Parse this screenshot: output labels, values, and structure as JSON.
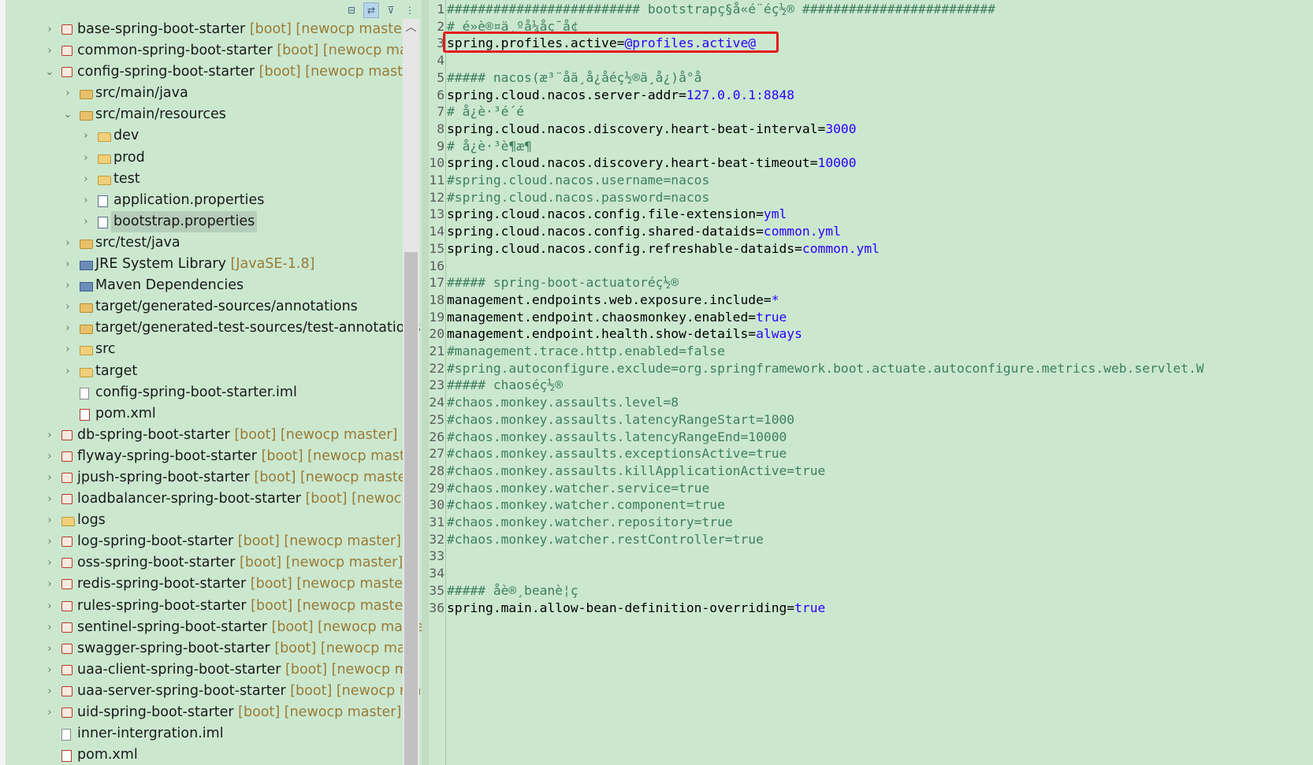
{
  "tree": {
    "items": [
      {
        "depth": 0,
        "exp": "collapsed",
        "icon": "project",
        "name": "base-spring-boot-starter",
        "deco": " [boot] [newocp master]"
      },
      {
        "depth": 0,
        "exp": "collapsed",
        "icon": "project",
        "name": "common-spring-boot-starter",
        "deco": " [boot] [newocp mas"
      },
      {
        "depth": 0,
        "exp": "expanded",
        "icon": "project",
        "name": "config-spring-boot-starter",
        "deco": " [boot] [newocp master"
      },
      {
        "depth": 1,
        "exp": "collapsed",
        "icon": "srcfolder",
        "name": "src/main/java",
        "deco": ""
      },
      {
        "depth": 1,
        "exp": "expanded",
        "icon": "srcfolder",
        "name": "src/main/resources",
        "deco": ""
      },
      {
        "depth": 2,
        "exp": "collapsed",
        "icon": "folder",
        "name": "dev",
        "deco": ""
      },
      {
        "depth": 2,
        "exp": "collapsed",
        "icon": "folder",
        "name": "prod",
        "deco": ""
      },
      {
        "depth": 2,
        "exp": "collapsed",
        "icon": "folder",
        "name": "test",
        "deco": ""
      },
      {
        "depth": 2,
        "exp": "collapsed",
        "icon": "pfile",
        "name": "application.properties",
        "deco": ""
      },
      {
        "depth": 2,
        "exp": "collapsed",
        "icon": "pfile",
        "name": "bootstrap.properties",
        "deco": "",
        "selected": true
      },
      {
        "depth": 1,
        "exp": "collapsed",
        "icon": "srcfolder",
        "name": "src/test/java",
        "deco": ""
      },
      {
        "depth": 1,
        "exp": "collapsed",
        "icon": "lib",
        "name": "JRE System Library",
        "deco": " [JavaSE-1.8]"
      },
      {
        "depth": 1,
        "exp": "collapsed",
        "icon": "lib",
        "name": "Maven Dependencies",
        "deco": ""
      },
      {
        "depth": 1,
        "exp": "collapsed",
        "icon": "srcfolder",
        "name": "target/generated-sources/annotations",
        "deco": ""
      },
      {
        "depth": 1,
        "exp": "collapsed",
        "icon": "srcfolder",
        "name": "target/generated-test-sources/test-annotations",
        "deco": ""
      },
      {
        "depth": 1,
        "exp": "collapsed",
        "icon": "folder",
        "name": "src",
        "deco": ""
      },
      {
        "depth": 1,
        "exp": "collapsed",
        "icon": "folder",
        "name": "target",
        "deco": ""
      },
      {
        "depth": 1,
        "exp": "none",
        "icon": "file",
        "name": "config-spring-boot-starter.iml",
        "deco": ""
      },
      {
        "depth": 1,
        "exp": "none",
        "icon": "xml",
        "name": "pom.xml",
        "deco": ""
      },
      {
        "depth": 0,
        "exp": "collapsed",
        "icon": "project",
        "name": "db-spring-boot-starter",
        "deco": " [boot] [newocp master]"
      },
      {
        "depth": 0,
        "exp": "collapsed",
        "icon": "project",
        "name": "flyway-spring-boot-starter",
        "deco": " [boot] [newocp master"
      },
      {
        "depth": 0,
        "exp": "collapsed",
        "icon": "project",
        "name": "jpush-spring-boot-starter",
        "deco": " [boot] [newocp master]"
      },
      {
        "depth": 0,
        "exp": "collapsed",
        "icon": "project",
        "name": "loadbalancer-spring-boot-starter",
        "deco": " [boot] [newocp"
      },
      {
        "depth": 0,
        "exp": "collapsed",
        "icon": "folder",
        "name": "logs",
        "deco": ""
      },
      {
        "depth": 0,
        "exp": "collapsed",
        "icon": "project",
        "name": "log-spring-boot-starter",
        "deco": " [boot] [newocp master]"
      },
      {
        "depth": 0,
        "exp": "collapsed",
        "icon": "project",
        "name": "oss-spring-boot-starter",
        "deco": " [boot] [newocp master]"
      },
      {
        "depth": 0,
        "exp": "collapsed",
        "icon": "project",
        "name": "redis-spring-boot-starter",
        "deco": " [boot] [newocp master]"
      },
      {
        "depth": 0,
        "exp": "collapsed",
        "icon": "project",
        "name": "rules-spring-boot-starter",
        "deco": " [boot] [newocp master]"
      },
      {
        "depth": 0,
        "exp": "collapsed",
        "icon": "project",
        "name": "sentinel-spring-boot-starter",
        "deco": " [boot] [newocp maste"
      },
      {
        "depth": 0,
        "exp": "collapsed",
        "icon": "project",
        "name": "swagger-spring-boot-starter",
        "deco": " [boot] [newocp mast"
      },
      {
        "depth": 0,
        "exp": "collapsed",
        "icon": "project",
        "name": "uaa-client-spring-boot-starter",
        "deco": " [boot] [newocp ma"
      },
      {
        "depth": 0,
        "exp": "collapsed",
        "icon": "project",
        "name": "uaa-server-spring-boot-starter",
        "deco": " [boot] [newocp ma"
      },
      {
        "depth": 0,
        "exp": "collapsed",
        "icon": "project",
        "name": "uid-spring-boot-starter",
        "deco": " [boot] [newocp master]"
      },
      {
        "depth": 0,
        "exp": "none",
        "icon": "file",
        "name": "inner-intergration.iml",
        "deco": ""
      },
      {
        "depth": 0,
        "exp": "none",
        "icon": "xml",
        "name": "pom.xml",
        "deco": ""
      }
    ]
  },
  "editor": {
    "lines": [
      {
        "n": "1",
        "parts": [
          [
            "c",
            "######################### bootstrapç§å«é¨éç½® #########################"
          ]
        ]
      },
      {
        "n": "2",
        "parts": [
          [
            "c",
            "# é»è®¤ä¸ºå¼åç¯å¢"
          ]
        ]
      },
      {
        "n": "3",
        "parts": [
          [
            "k",
            "spring.profiles.active="
          ],
          [
            "v",
            "@profiles.active@"
          ]
        ]
      },
      {
        "n": "4",
        "parts": []
      },
      {
        "n": "5",
        "parts": [
          [
            "c",
            "##### nacos(æ³¨åä¸­å¿åéç½®ä¸­å¿)å°å"
          ]
        ]
      },
      {
        "n": "6",
        "parts": [
          [
            "k",
            "spring.cloud.nacos.server-addr="
          ],
          [
            "v",
            "127.0.0.1:8848"
          ]
        ]
      },
      {
        "n": "7",
        "parts": [
          [
            "c",
            "# å¿è·³é´é"
          ]
        ]
      },
      {
        "n": "8",
        "parts": [
          [
            "k",
            "spring.cloud.nacos.discovery.heart-beat-interval="
          ],
          [
            "v",
            "3000"
          ]
        ]
      },
      {
        "n": "9",
        "parts": [
          [
            "c",
            "# å¿è·³è¶æ¶"
          ]
        ]
      },
      {
        "n": "10",
        "parts": [
          [
            "k",
            "spring.cloud.nacos.discovery.heart-beat-timeout="
          ],
          [
            "v",
            "10000"
          ]
        ]
      },
      {
        "n": "11",
        "parts": [
          [
            "c",
            "#spring.cloud.nacos.username=nacos"
          ]
        ]
      },
      {
        "n": "12",
        "parts": [
          [
            "c",
            "#spring.cloud.nacos.password=nacos"
          ]
        ]
      },
      {
        "n": "13",
        "parts": [
          [
            "k",
            "spring.cloud.nacos.config.file-extension="
          ],
          [
            "v",
            "yml"
          ]
        ]
      },
      {
        "n": "14",
        "parts": [
          [
            "k",
            "spring.cloud.nacos.config.shared-dataids="
          ],
          [
            "v",
            "common.yml"
          ]
        ]
      },
      {
        "n": "15",
        "parts": [
          [
            "k",
            "spring.cloud.nacos.config.refreshable-dataids="
          ],
          [
            "v",
            "common.yml"
          ]
        ]
      },
      {
        "n": "16",
        "parts": []
      },
      {
        "n": "17",
        "parts": [
          [
            "c",
            "##### spring-boot-actuatoréç½®"
          ]
        ]
      },
      {
        "n": "18",
        "parts": [
          [
            "k",
            "management.endpoints.web.exposure.include="
          ],
          [
            "v",
            "*"
          ]
        ]
      },
      {
        "n": "19",
        "parts": [
          [
            "k",
            "management.endpoint.chaosmonkey.enabled="
          ],
          [
            "v",
            "true"
          ]
        ]
      },
      {
        "n": "20",
        "parts": [
          [
            "k",
            "management.endpoint.health.show-details="
          ],
          [
            "v",
            "always"
          ]
        ]
      },
      {
        "n": "21",
        "parts": [
          [
            "c",
            "#management.trace.http.enabled=false"
          ]
        ]
      },
      {
        "n": "22",
        "parts": [
          [
            "c",
            "#spring.autoconfigure.exclude=org.springframework.boot.actuate.autoconfigure.metrics.web.servlet.W"
          ]
        ]
      },
      {
        "n": "23",
        "parts": [
          [
            "c",
            "##### chaoséç½®"
          ]
        ]
      },
      {
        "n": "24",
        "parts": [
          [
            "c",
            "#chaos.monkey.assaults.level=8"
          ]
        ]
      },
      {
        "n": "25",
        "parts": [
          [
            "c",
            "#chaos.monkey.assaults.latencyRangeStart=1000"
          ]
        ]
      },
      {
        "n": "26",
        "parts": [
          [
            "c",
            "#chaos.monkey.assaults.latencyRangeEnd=10000"
          ]
        ]
      },
      {
        "n": "27",
        "parts": [
          [
            "c",
            "#chaos.monkey.assaults.exceptionsActive=true"
          ]
        ]
      },
      {
        "n": "28",
        "parts": [
          [
            "c",
            "#chaos.monkey.assaults.killApplicationActive=true"
          ]
        ]
      },
      {
        "n": "29",
        "parts": [
          [
            "c",
            "#chaos.monkey.watcher.service=true"
          ]
        ]
      },
      {
        "n": "30",
        "parts": [
          [
            "c",
            "#chaos.monkey.watcher.component=true"
          ]
        ]
      },
      {
        "n": "31",
        "parts": [
          [
            "c",
            "#chaos.monkey.watcher.repository=true"
          ]
        ]
      },
      {
        "n": "32",
        "parts": [
          [
            "c",
            "#chaos.monkey.watcher.restController=true"
          ]
        ]
      },
      {
        "n": "33",
        "parts": []
      },
      {
        "n": "34",
        "parts": []
      },
      {
        "n": "35",
        "parts": [
          [
            "c",
            "##### åè®¸beanè¦ç"
          ]
        ]
      },
      {
        "n": "36",
        "parts": [
          [
            "k",
            "spring.main.allow-bean-definition-overriding="
          ],
          [
            "v",
            "true"
          ]
        ]
      }
    ]
  },
  "colors": {
    "background": "#cbe8cf",
    "highlight_box": "#e51c1c",
    "value_text": "#2a00ff",
    "comment_text": "#3f7f5f"
  }
}
